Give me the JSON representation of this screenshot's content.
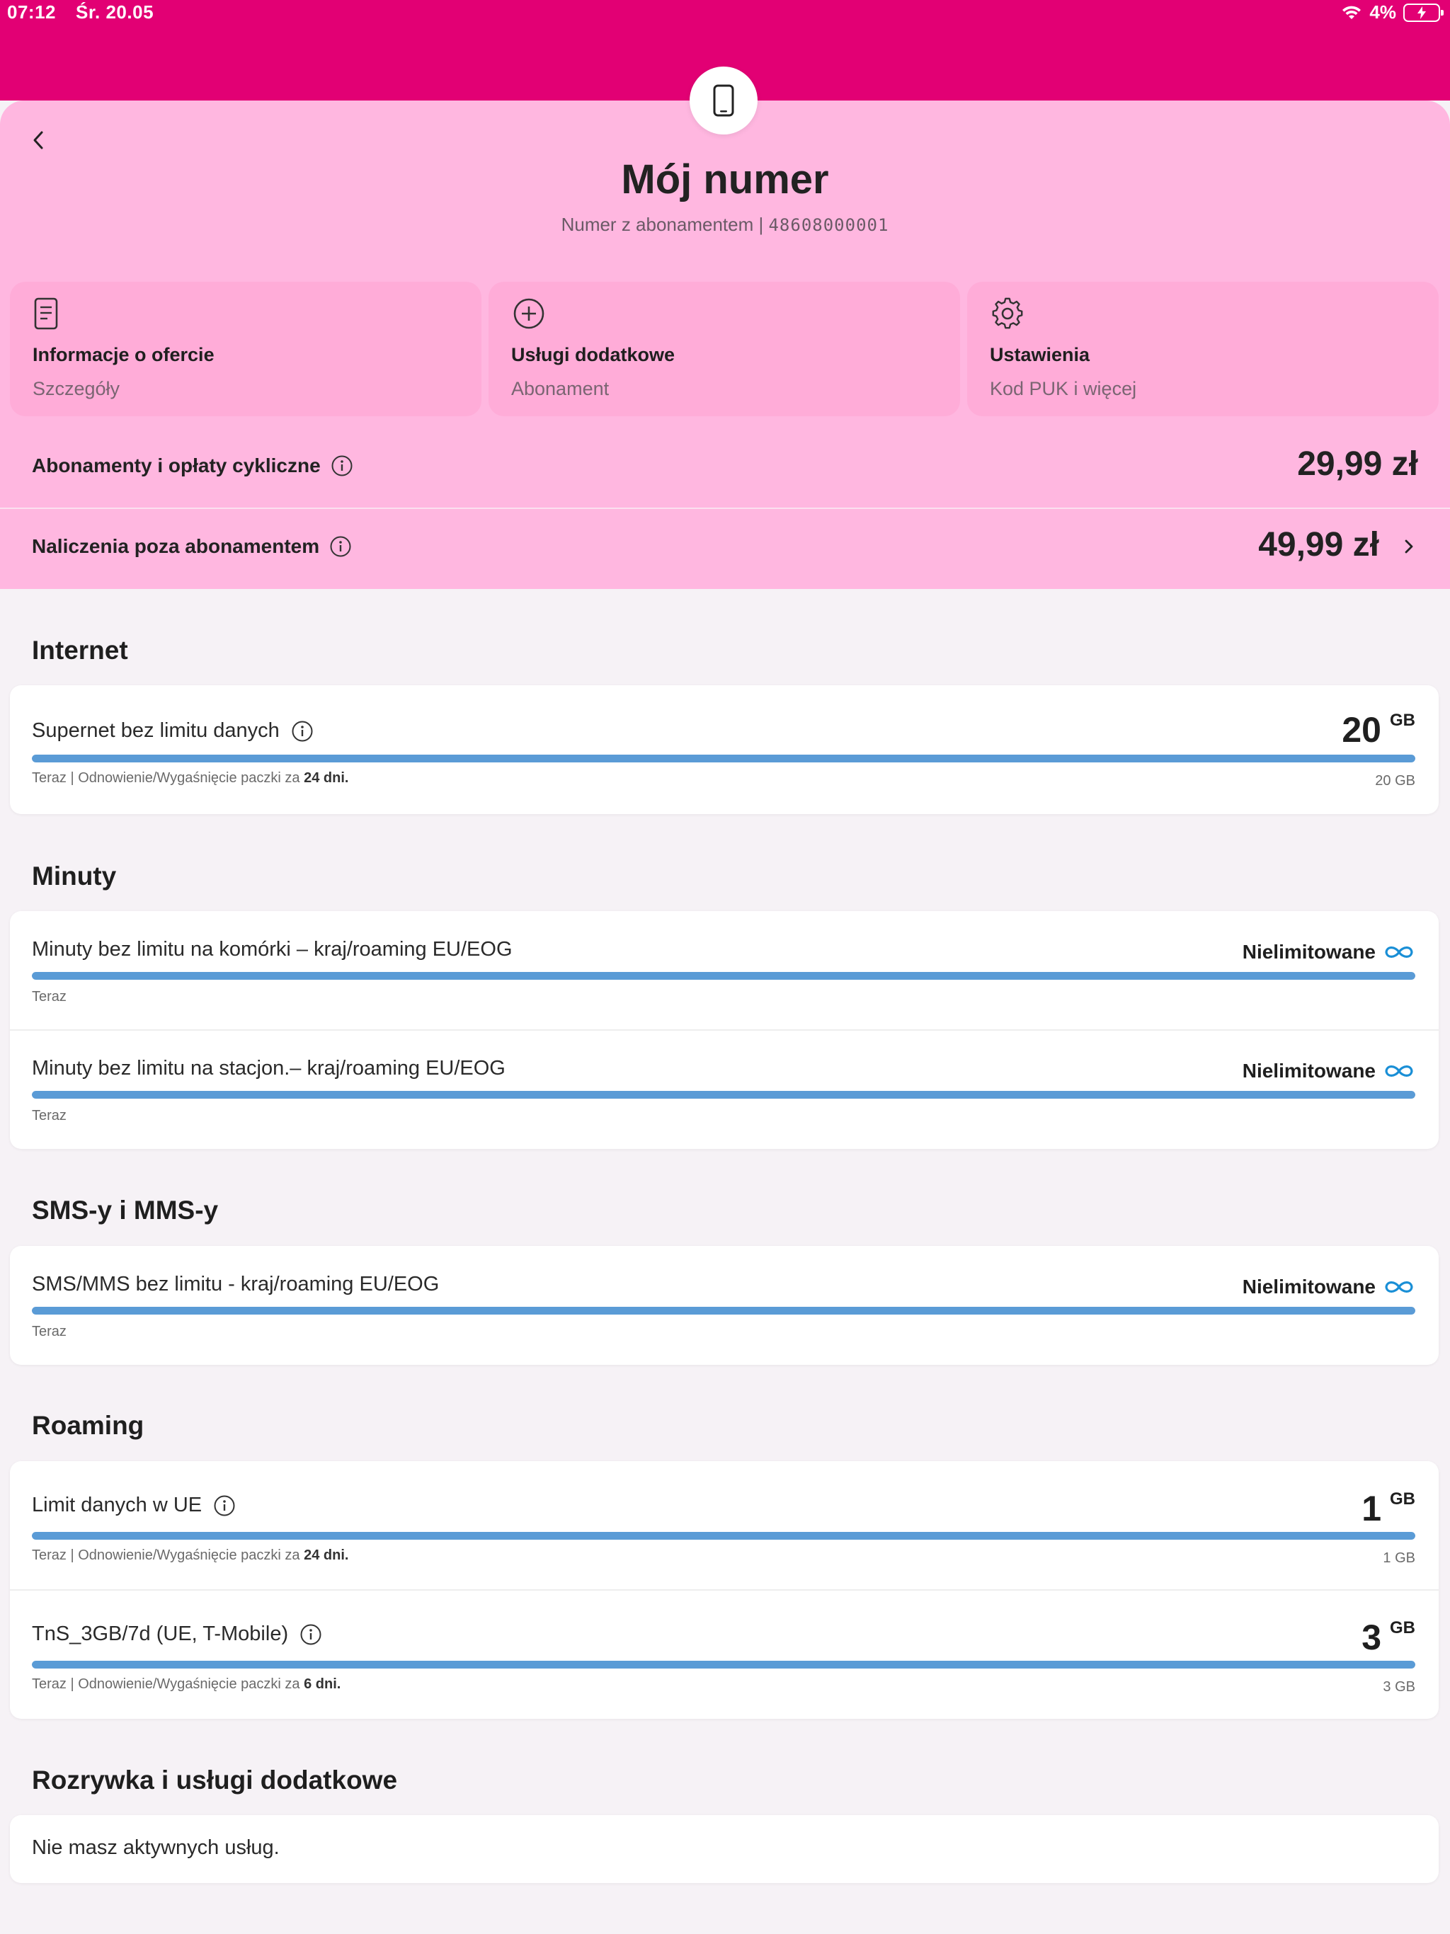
{
  "status": {
    "time": "07:12",
    "date": "Śr. 20.05",
    "battery": "4%"
  },
  "header": {
    "title": "Mój numer",
    "subtitle_prefix": "Numer z abonamentem | ",
    "number": "48608000001"
  },
  "tiles": [
    {
      "title": "Informacje o ofercie",
      "subtitle": "Szczegóły",
      "icon": "document-icon"
    },
    {
      "title": "Usługi dodatkowe",
      "subtitle": "Abonament",
      "icon": "plus-circle-icon"
    },
    {
      "title": "Ustawienia",
      "subtitle": "Kod PUK i więcej",
      "icon": "gear-icon"
    }
  ],
  "fees": {
    "recurring_label": "Abonamenty i opłaty cykliczne",
    "recurring_amount": "29,99 zł",
    "extra_label": "Naliczenia poza abonamentem",
    "extra_amount": "49,99 zł"
  },
  "sections": {
    "internet": "Internet",
    "minutes": "Minuty",
    "sms": "SMS-y i MMS-y",
    "roaming": "Roaming",
    "entertainment": "Rozrywka i usługi dodatkowe"
  },
  "internet": {
    "label": "Supernet bez limitu danych",
    "value": "20",
    "unit": "GB",
    "meta_prefix": "Teraz | Odnowienie/Wygaśnięcie paczki za ",
    "meta_days": "24 dni.",
    "total": "20 GB",
    "fill": 1.0
  },
  "minutes": [
    {
      "label": "Minuty bez limitu na komórki – kraj/roaming EU/EOG",
      "status": "Nielimitowane",
      "meta": "Teraz",
      "fill": 1.0
    },
    {
      "label": "Minuty bez limitu na stacjon.– kraj/roaming EU/EOG",
      "status": "Nielimitowane",
      "meta": "Teraz",
      "fill": 1.0
    }
  ],
  "sms": {
    "label": "SMS/MMS bez limitu  - kraj/roaming EU/EOG",
    "status": "Nielimitowane",
    "meta": "Teraz",
    "fill": 1.0
  },
  "roaming": [
    {
      "label": "Limit danych w UE",
      "value": "1",
      "unit": "GB",
      "meta_prefix": "Teraz | Odnowienie/Wygaśnięcie paczki za ",
      "meta_days": "24 dni.",
      "total": "1 GB",
      "fill": 1.0
    },
    {
      "label": "TnS_3GB/7d (UE, T-Mobile)",
      "value": "3",
      "unit": "GB",
      "meta_prefix": "Teraz | Odnowienie/Wygaśnięcie paczki za ",
      "meta_days": "6 dni.",
      "total": "3 GB",
      "fill": 1.0
    }
  ],
  "entertainment": {
    "empty_text": "Nie masz aktywnych usług."
  },
  "colors": {
    "brand": "#e20074",
    "panel": "#ffb7e0",
    "bar": "#5a9bd6",
    "infinity": "#1a8fd6"
  }
}
